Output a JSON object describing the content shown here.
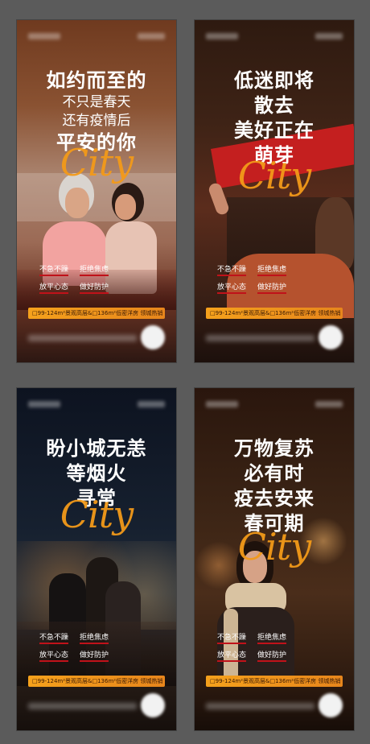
{
  "posters": [
    {
      "headline": [
        "如约而至的",
        "不只是春天",
        "还有疫情后",
        "平安的你"
      ],
      "city": "City",
      "slogans": [
        [
          "不急不躁",
          "拒绝焦虑"
        ],
        [
          "放平心态",
          "做好防护"
        ]
      ],
      "banner": "□99-124m²景观高层&□136m²低密洋房 领城热销"
    },
    {
      "headline": [
        "低迷即将",
        "散去",
        "美好正在",
        "萌芽"
      ],
      "city": "City",
      "slogans": [
        [
          "不急不躁",
          "拒绝焦虑"
        ],
        [
          "放平心态",
          "做好防护"
        ]
      ],
      "banner": "□99-124m²景观高层&□136m²低密洋房 领城热销"
    },
    {
      "headline": [
        "盼小城无恙",
        "等烟火",
        "寻常"
      ],
      "city": "City",
      "slogans": [
        [
          "不急不躁",
          "拒绝焦虑"
        ],
        [
          "放平心态",
          "做好防护"
        ]
      ],
      "banner": "□99-124m²景观高层&□136m²低密洋房 领城热销"
    },
    {
      "headline": [
        "万物复苏",
        "必有时",
        "疫去安来",
        "春可期"
      ],
      "city": "City",
      "slogans": [
        [
          "不急不躁",
          "拒绝焦虑"
        ],
        [
          "放平心态",
          "做好防护"
        ]
      ],
      "banner": "□99-124m²景观高层&□136m²低密洋房 领城热销"
    }
  ],
  "colors": {
    "accent": "#f39a19",
    "underline": "#c0121a",
    "board": "#5b5b5b"
  }
}
